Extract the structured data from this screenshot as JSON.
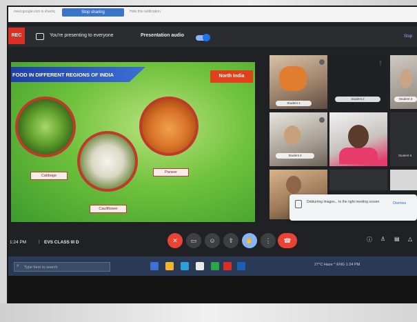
{
  "browser": {
    "tab_text": "meet.google.com is sharing your screen",
    "sharing_button": "Stop sharing",
    "hide_text": "Hide this notification"
  },
  "presenting_banner": {
    "stop_label": "REC",
    "text": "You're presenting to everyone",
    "audio_label": "Presentation audio",
    "audio_on": true,
    "right_action": "Stop"
  },
  "slide": {
    "title": "FOOD IN DIFFERENT REGIONS OF INDIA",
    "region": "North India",
    "foods": [
      {
        "name": "cabbage",
        "label": "Cabbage"
      },
      {
        "name": "cauliflower",
        "label": "Cauliflower"
      },
      {
        "name": "paneer",
        "label": "Paneer"
      }
    ]
  },
  "participants": {
    "names": [
      "Student 1",
      "Student 2",
      "Student 3",
      "Student 4",
      "",
      "Student 6"
    ]
  },
  "notification": {
    "text": "Deblurring images... to the right meeting screen",
    "action": "Dismiss"
  },
  "controls": {
    "time": "1:24 PM",
    "separator": "|",
    "meeting_name": "EVS CLASS III D",
    "mic_icon": "mic-off-icon",
    "cc_icon": "captions-icon",
    "emoji_icon": "emoji-icon",
    "present_icon": "present-icon",
    "hand_icon": "raise-hand-icon",
    "more_icon": "more-icon",
    "leave_icon": "call-end-icon"
  },
  "taskbar": {
    "search_placeholder": "Type here to search",
    "tray_text": "27°C Haze  ^  ENG  1:24 PM"
  },
  "colors": {
    "meet_dark": "#202124",
    "slide_green": "#6fc23c",
    "title_blue": "#1e3fa8",
    "region_red": "#e0411b",
    "end_call_red": "#ea4335"
  }
}
